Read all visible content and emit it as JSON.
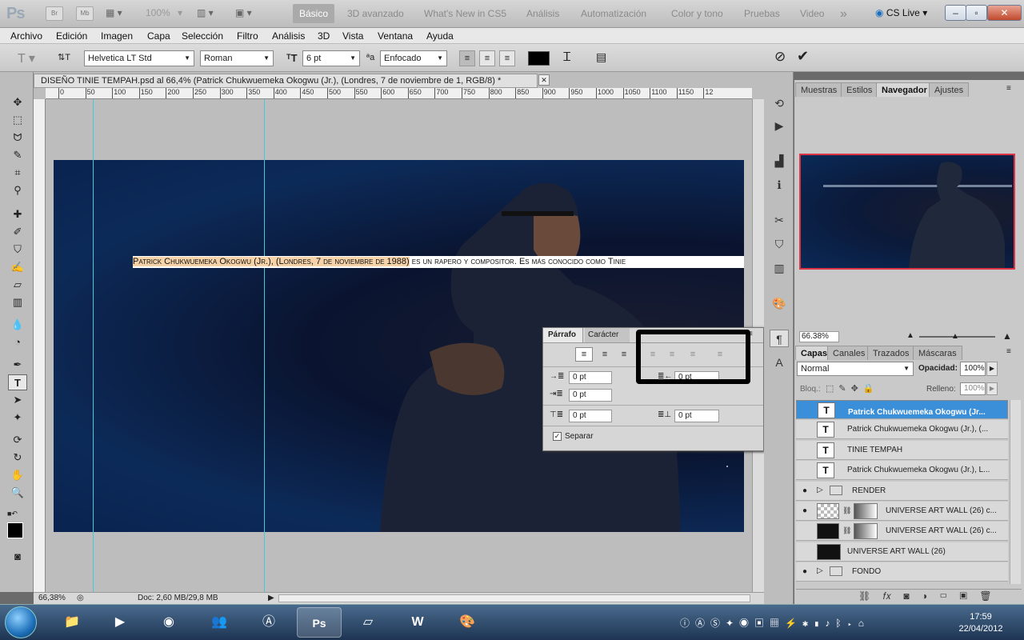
{
  "app": {
    "logo": "Ps",
    "mini_icons": [
      "Br",
      "Mb"
    ],
    "zoom_combo": "100%",
    "workspaces": [
      "Básico",
      "3D avanzado",
      "What's New in CS5",
      "Análisis",
      "Automatización",
      "Color y tono",
      "Pruebas",
      "Video"
    ],
    "more": "»",
    "cs_live": "CS Live"
  },
  "window_controls": {
    "min": "–",
    "max": "▫",
    "close": "✕"
  },
  "menu": [
    "Archivo",
    "Edición",
    "Imagen",
    "Capa",
    "Selección",
    "Filtro",
    "Análisis",
    "3D",
    "Vista",
    "Ventana",
    "Ayuda"
  ],
  "options": {
    "font_family": "Helvetica LT Std",
    "font_style": "Roman",
    "font_size": "6 pt",
    "aa_label": "ªa",
    "antialias": "Enfocado",
    "color_swatch": "#000000"
  },
  "document": {
    "tab_title": "DISEÑO TINIE TEMPAH.psd al 66,4% (Patrick Chukwuemeka Okogwu (Jr.), (Londres, 7 de noviembre de 1, RGB/8) *",
    "ruler_ticks": [
      "0",
      "50",
      "100",
      "150",
      "200",
      "250",
      "300",
      "350",
      "400",
      "450",
      "500",
      "550",
      "600",
      "650",
      "700",
      "750",
      "800",
      "850",
      "900",
      "950",
      "1000",
      "1050",
      "1100",
      "1150",
      "12"
    ],
    "text_highlight": "Patrick Chukwuemeka Okogwu (Jr.), (Londres, 7 de noviembre de 1988)",
    "text_rest": " es un rapero y compositor. Es más conocido como Tinie",
    "zoom": "66,38%",
    "doc_size": "Doc: 2,60 MB/29,8 MB"
  },
  "paragraph_panel": {
    "tabs": [
      "Párrafo",
      "Carácter"
    ],
    "indent_left": "0 pt",
    "indent_right": "0 pt",
    "first_line": "0 pt",
    "space_before": "0 pt",
    "space_after": "0 pt",
    "hyphenate_label": "Separar"
  },
  "navigator": {
    "tabs": [
      "Muestras",
      "Estilos",
      "Navegador",
      "Ajustes"
    ],
    "zoom": "66.38%"
  },
  "layers": {
    "tabs": [
      "Capas",
      "Canales",
      "Trazados",
      "Máscaras"
    ],
    "blend_mode": "Normal",
    "opacity_label": "Opacidad:",
    "opacity": "100%",
    "lock_label": "Bloq.:",
    "fill_label": "Relleno:",
    "fill": "100%",
    "rows": [
      {
        "name": "Patrick Chukwuemeka Okogwu (Jr...",
        "thumb": "T",
        "eye": false
      },
      {
        "name": "Patrick Chukwuemeka Okogwu (Jr.), (...",
        "thumb": "T",
        "eye": false
      },
      {
        "name": "TINIE TEMPAH",
        "thumb": "T",
        "eye": false
      },
      {
        "name": "Patrick Chukwuemeka Okogwu (Jr.), L...",
        "thumb": "T",
        "eye": false
      },
      {
        "name": "RENDER",
        "thumb": "",
        "eye": true
      },
      {
        "name": "UNIVERSE ART WALL (26) c...",
        "thumb": "",
        "eye": true
      },
      {
        "name": "UNIVERSE ART WALL (26) c...",
        "thumb": "",
        "eye": false
      },
      {
        "name": "UNIVERSE ART WALL (26)",
        "thumb": "",
        "eye": false
      },
      {
        "name": "FONDO",
        "thumb": "",
        "eye": true
      }
    ]
  },
  "taskbar": {
    "time": "17:59",
    "date": "22/04/2012",
    "apps": [
      "explorer",
      "media-player",
      "chrome",
      "messenger",
      "avast",
      "photoshop",
      "notepad",
      "word",
      "paint"
    ]
  },
  "icons": {
    "eye": "👁",
    "type_tool": "T",
    "folder": "▸"
  }
}
